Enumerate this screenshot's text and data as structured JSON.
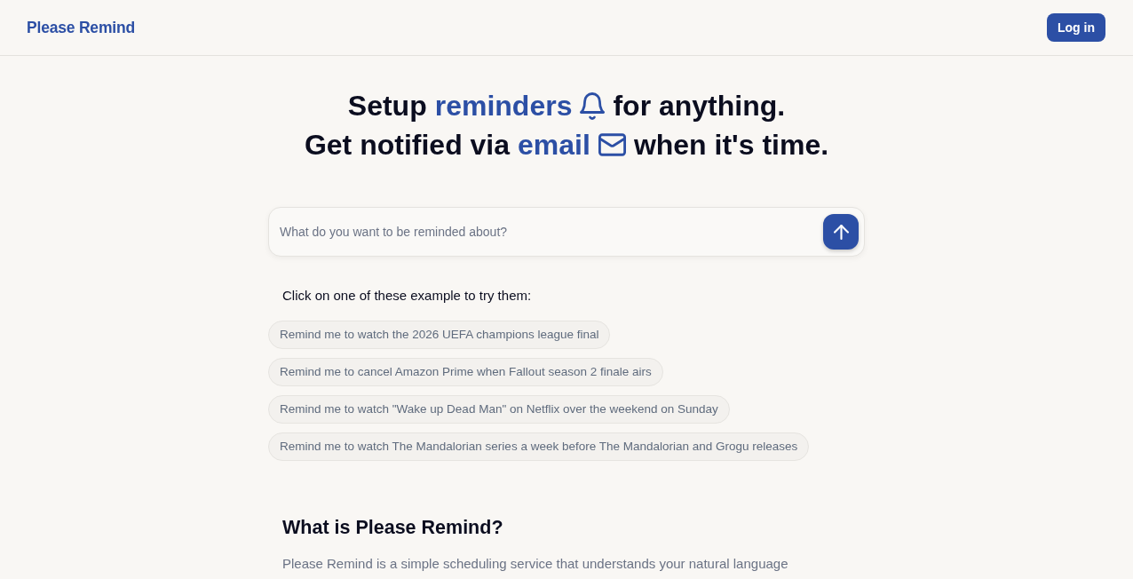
{
  "navbar": {
    "brand": "Please Remind",
    "login_button": "Log in"
  },
  "hero": {
    "lines": [
      {
        "before": "Setup",
        "highlight": "reminders",
        "after": "for anything."
      },
      {
        "before": "Get notified via",
        "highlight": "email",
        "after": "when it's time."
      }
    ]
  },
  "search": {
    "placeholder": "What do you want to be reminded about?"
  },
  "examples": {
    "prompt": "Click on one of these example to try them:",
    "items": [
      "Remind me to watch the 2026 UEFA champions league final",
      "Remind me to cancel Amazon Prime when Fallout season 2 finale airs",
      "Remind me to watch \"Wake up Dead Man\" on Netflix over the weekend on Sunday",
      "Remind me to watch The Mandalorian series a week before The Mandalorian and Grogu releases"
    ]
  },
  "about": {
    "title": "What is Please Remind?",
    "text": "Please Remind is a simple scheduling service that understands your natural language"
  }
}
